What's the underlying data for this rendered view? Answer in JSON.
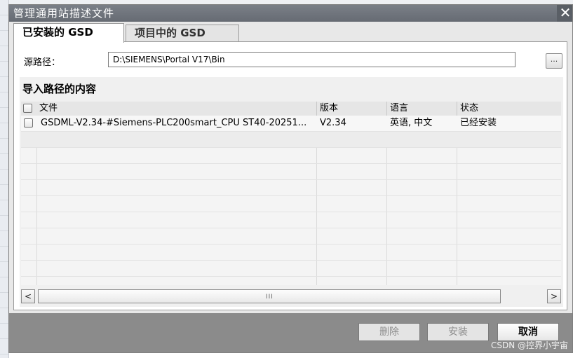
{
  "window": {
    "title": "管理通用站描述文件",
    "close_glyph": "✕"
  },
  "tabs": [
    {
      "label": "已安装的 GSD",
      "active": true
    },
    {
      "label": "项目中的 GSD",
      "active": false
    }
  ],
  "source": {
    "label": "源路径：",
    "value": "D:\\SIEMENS\\Portal V17\\Bin",
    "browse_label": "..."
  },
  "content": {
    "title": "导入路径的内容",
    "columns": {
      "file": "文件",
      "version": "版本",
      "language": "语言",
      "status": "状态"
    },
    "rows": [
      {
        "checked": false,
        "file": "GSDML-V2.34-#Siemens-PLC200smart_CPU ST40-20251...",
        "version": "V2.34",
        "language": "英语, 中文",
        "status": "已经安装"
      }
    ],
    "scroll_grip": "III",
    "scroll_left": "<",
    "scroll_right": ">"
  },
  "buttons": {
    "delete": "删除",
    "install": "安装",
    "cancel": "取消"
  },
  "watermark": "CSDN @控界小宇宙",
  "colors": {
    "titlebar": "#6f747c",
    "footer": "#8b8b8b",
    "panel": "#ffffff",
    "section": "#f0f0f0"
  },
  "icons": {
    "close": "close-icon",
    "browse": "ellipsis-icon",
    "checkbox": "checkbox-icon"
  }
}
